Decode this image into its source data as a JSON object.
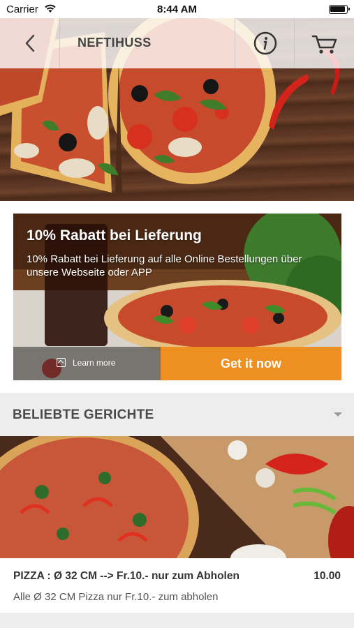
{
  "status_bar": {
    "carrier": "Carrier",
    "time": "8:44 AM"
  },
  "nav": {
    "title": "NEFTIHUSS",
    "back_icon": "chevron-left-icon",
    "info_icon": "info-icon",
    "cart_icon": "cart-icon"
  },
  "promo": {
    "title": "10% Rabatt bei Lieferung",
    "text": "10% Rabatt bei Lieferung auf alle Online Bestellungen über unsere Webseite oder APP",
    "learn_more": "Learn more",
    "cta": "Get it now",
    "cta_color": "#ee8f22"
  },
  "section": {
    "title": "BELIEBTE GERICHTE",
    "chevron_icon": "chevron-down-icon"
  },
  "dishes": [
    {
      "name": "PIZZA : Ø 32 CM --> Fr.10.- nur zum Abholen",
      "price": "10.00",
      "description": "Alle Ø 32 CM Pizza nur Fr.10.- zum abholen"
    }
  ]
}
